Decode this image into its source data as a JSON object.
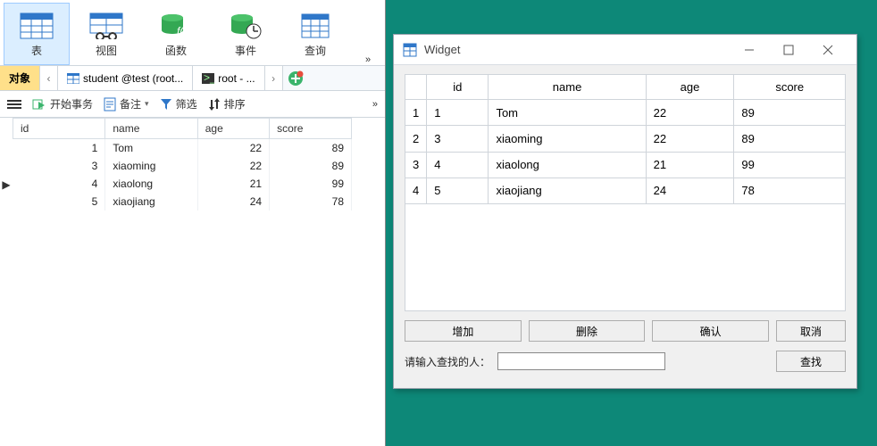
{
  "ribbon": {
    "items": [
      {
        "label": "表",
        "icon": "table-icon"
      },
      {
        "label": "视图",
        "icon": "view-icon"
      },
      {
        "label": "函数",
        "icon": "function-icon"
      },
      {
        "label": "事件",
        "icon": "event-icon"
      },
      {
        "label": "查询",
        "icon": "query-icon"
      }
    ]
  },
  "tabs": {
    "objects": "对象",
    "student": "student @test (root...",
    "root": "root - ..."
  },
  "toolbar": {
    "begin_tx": "开始事务",
    "remark": "备注",
    "filter": "筛选",
    "sort": "排序"
  },
  "grid": {
    "headers": [
      "id",
      "name",
      "age",
      "score"
    ],
    "rows": [
      {
        "id": 1,
        "name": "Tom",
        "age": 22,
        "score": 89
      },
      {
        "id": 3,
        "name": "xiaoming",
        "age": 22,
        "score": 89
      },
      {
        "id": 4,
        "name": "xiaolong",
        "age": 21,
        "score": 99
      },
      {
        "id": 5,
        "name": "xiaojiang",
        "age": 24,
        "score": 78
      }
    ],
    "current_row_index": 2
  },
  "qt": {
    "title": "Widget",
    "headers": [
      "id",
      "name",
      "age",
      "score"
    ],
    "rows": [
      {
        "n": "1",
        "id": "1",
        "name": "Tom",
        "age": "22",
        "score": "89"
      },
      {
        "n": "2",
        "id": "3",
        "name": "xiaoming",
        "age": "22",
        "score": "89"
      },
      {
        "n": "3",
        "id": "4",
        "name": "xiaolong",
        "age": "21",
        "score": "99"
      },
      {
        "n": "4",
        "id": "5",
        "name": "xiaojiang",
        "age": "24",
        "score": "78"
      }
    ],
    "buttons": {
      "add": "增加",
      "del": "删除",
      "ok": "确认",
      "cancel": "取消",
      "search": "查找"
    },
    "search_label": "请输入查找的人：",
    "search_value": ""
  }
}
